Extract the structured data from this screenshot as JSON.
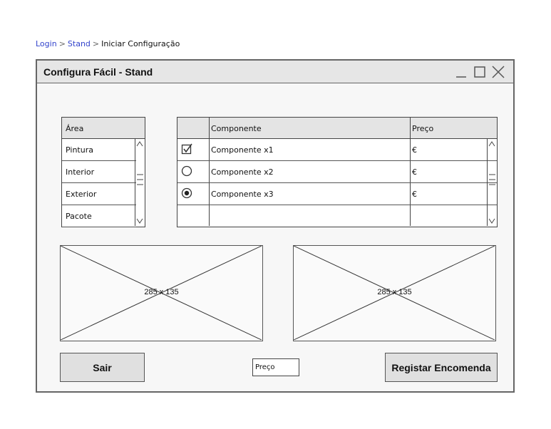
{
  "breadcrumb": {
    "items": [
      "Login",
      "Stand",
      "Iniciar Configuração"
    ],
    "separator": ">"
  },
  "window": {
    "title": "Configura Fácil - Stand",
    "controls": [
      "minimize-icon",
      "maximize-icon",
      "close-icon"
    ]
  },
  "area_list": {
    "header": "Área",
    "items": [
      "Pintura",
      "Interior",
      "Exterior",
      "Pacote"
    ]
  },
  "components": {
    "headers": [
      "",
      "Componente",
      "Preço"
    ],
    "rows": [
      {
        "selector": "checkbox-checked",
        "name": "Componente x1",
        "price": "€"
      },
      {
        "selector": "radio-unchecked",
        "name": "Componente x2",
        "price": "€"
      },
      {
        "selector": "radio-checked",
        "name": "Componente x3",
        "price": "€"
      },
      {
        "selector": "",
        "name": "",
        "price": ""
      }
    ]
  },
  "images": [
    {
      "label": "285 x 135"
    },
    {
      "label": "285 x 135"
    }
  ],
  "buttons": {
    "exit": "Sair",
    "register": "Registar Encomenda"
  },
  "price_field": {
    "value": "Preço"
  },
  "colors": {
    "link": "#3344cc",
    "titlebar": "#e6e6e6",
    "header_fill": "#e4e4e4",
    "button_fill": "#e0e0e0"
  }
}
